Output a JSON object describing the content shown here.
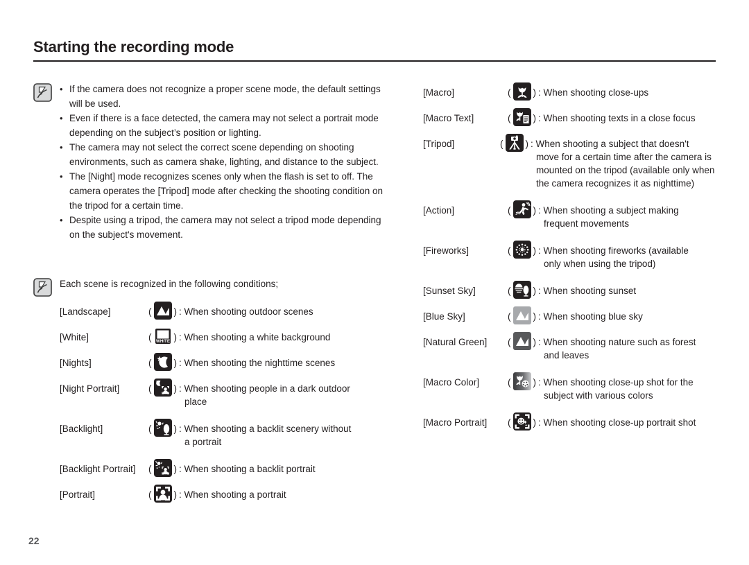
{
  "document": {
    "title": "Starting the recording mode",
    "page_number": "22"
  },
  "notes": {
    "icon": "memo-note-icon",
    "items": [
      "If the camera does not recognize a proper scene mode, the default settings will be used.",
      "Even if there is a face detected, the camera may not select a portrait mode depending on the subject’s position or lighting.",
      "The camera may not select the correct scene depending on shooting environments, such as camera shake, lighting, and distance to the subject.",
      "The [Night] mode recognizes scenes only when the flash is set to off. The camera operates the [Tripod] mode after checking the shooting condition on the tripod for a certain time.",
      "Despite using a tripod, the camera may not select a tripod mode depending on the subject's movement."
    ]
  },
  "scenes_intro": {
    "icon": "memo-note-icon",
    "text": "Each scene is recognized in the following conditions;"
  },
  "punctuation": {
    "open": "(",
    "close": ")",
    "colon": ":"
  },
  "colors": {
    "text": "#231f20",
    "icon_dark": "#231f20",
    "icon_gray": "#808285",
    "rule": "#231f20",
    "page_number": "#58595b"
  },
  "left_scenes": [
    {
      "name": "[Landscape]",
      "icon": "landscape-icon",
      "desc": "When shooting outdoor scenes",
      "cont": ""
    },
    {
      "name": "[White]",
      "icon": "white-balance-icon",
      "desc": "When shooting a white background",
      "cont": ""
    },
    {
      "name": "[Nights]",
      "icon": "night-moon-star-icon",
      "desc": "When shooting the nighttime scenes",
      "cont": ""
    },
    {
      "name": "[Night Portrait]",
      "icon": "night-portrait-icon",
      "desc": "When shooting people in a dark outdoor",
      "cont": "place"
    },
    {
      "name": "[Backlight]",
      "icon": "backlight-icon",
      "desc": "When shooting a backlit scenery without",
      "cont": "a portrait"
    },
    {
      "name": "[Backlight Portrait]",
      "icon": "backlight-portrait-icon",
      "desc": "When shooting a backlit portrait",
      "cont": ""
    },
    {
      "name": "[Portrait]",
      "icon": "portrait-icon",
      "desc": "When shooting a portrait",
      "cont": ""
    }
  ],
  "right_scenes": [
    {
      "name": "[Macro]",
      "icon": "macro-tulip-icon",
      "desc": "When shooting close-ups",
      "cont": ""
    },
    {
      "name": "[Macro Text]",
      "icon": "macro-text-icon",
      "desc": "When shooting texts in a close focus",
      "cont": ""
    },
    {
      "name": "[Tripod]",
      "icon": "tripod-icon",
      "desc": "When shooting a subject that doesn't",
      "cont": "move for a certain time after the camera is mounted on the tripod (available only when the camera recognizes it as nighttime)"
    },
    {
      "name": "[Action]",
      "icon": "action-runner-icon",
      "desc": "When shooting a subject making",
      "cont": "frequent movements"
    },
    {
      "name": "[Fireworks]",
      "icon": "fireworks-icon",
      "desc": "When shooting fireworks (available",
      "cont": "only when using the tripod)"
    },
    {
      "name": "[Sunset Sky]",
      "icon": "sunset-sky-icon",
      "desc": "When shooting sunset",
      "cont": ""
    },
    {
      "name": "[Blue Sky]",
      "icon": "blue-sky-icon",
      "desc": "When shooting blue sky",
      "cont": ""
    },
    {
      "name": "[Natural Green]",
      "icon": "natural-green-icon",
      "desc": "When shooting nature such as forest",
      "cont": "and leaves"
    },
    {
      "name": "[Macro Color]",
      "icon": "macro-color-icon",
      "desc": "When shooting close-up shot for the",
      "cont": "subject with various colors"
    },
    {
      "name": "[Macro Portrait]",
      "icon": "macro-portrait-icon",
      "desc": "When shooting close-up portrait shot",
      "cont": ""
    }
  ]
}
